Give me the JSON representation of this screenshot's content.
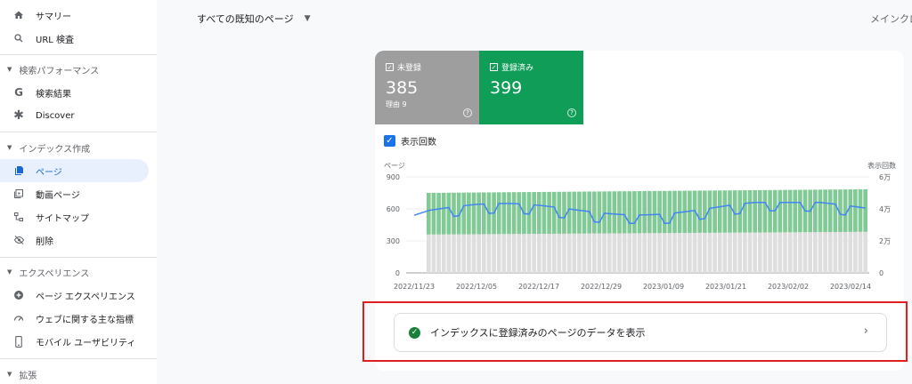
{
  "sidebar": {
    "summary": "サマリー",
    "url_inspection": "URL 検査",
    "section_performance": "検索パフォーマンス",
    "search_results": "検索結果",
    "discover": "Discover",
    "section_indexing": "インデックス作成",
    "pages": "ページ",
    "video_pages": "動画ページ",
    "sitemaps": "サイトマップ",
    "removals": "削除",
    "section_experience": "エクスペリエンス",
    "page_experience": "ページ エクスペリエンス",
    "core_web_vitals": "ウェブに関する主な指標",
    "mobile_usability": "モバイル ユーザビリティ",
    "section_enhancements": "拡張"
  },
  "header": {
    "filter": "すべての既知のページ",
    "domain": "メインクロ"
  },
  "tiles": {
    "unregistered": {
      "label": "未登録",
      "value": "385",
      "reason": "理由 9"
    },
    "registered": {
      "label": "登録済み",
      "value": "399"
    }
  },
  "impressions_label": "表示回数",
  "colors": {
    "unregistered": "#9e9e9e",
    "registered": "#0f9d58",
    "registered_bar": "#81c995",
    "unregistered_bar": "#dedede",
    "impressions_line": "#4285f4",
    "highlight": "#e02020"
  },
  "chart_data": {
    "type": "bar",
    "stacked": true,
    "left_axis_title": "ページ",
    "right_axis_title": "表示回数",
    "left_ticks": [
      "0",
      "300",
      "600",
      "900"
    ],
    "right_ticks": [
      "0",
      "2万",
      "4万",
      "6万"
    ],
    "ylim": [
      0,
      900
    ],
    "ylim_right": [
      0,
      60000
    ],
    "x_labels": [
      "2022/11/23",
      "2022/12/05",
      "2022/12/17",
      "2022/12/29",
      "2023/01/09",
      "2023/01/21",
      "2023/02/02",
      "2023/02/14"
    ],
    "x_first": "2022/11/23",
    "x_last": "2023/02/19",
    "series": [
      {
        "name": "未登録",
        "values_summary": "approx. 360 rising to 385 over the period",
        "start": 360,
        "end": 385
      },
      {
        "name": "登録済み",
        "values_summary": "approx. 390 declining slightly to 399",
        "start": 390,
        "end": 399
      },
      {
        "name": "表示回数",
        "values_summary": "approx. 35000–42000 with weekly dips to ~31000",
        "min": 31000,
        "max": 44000
      }
    ]
  },
  "link": {
    "label": "インデックスに登録済みのページのデータを表示",
    "chevron": "›"
  }
}
